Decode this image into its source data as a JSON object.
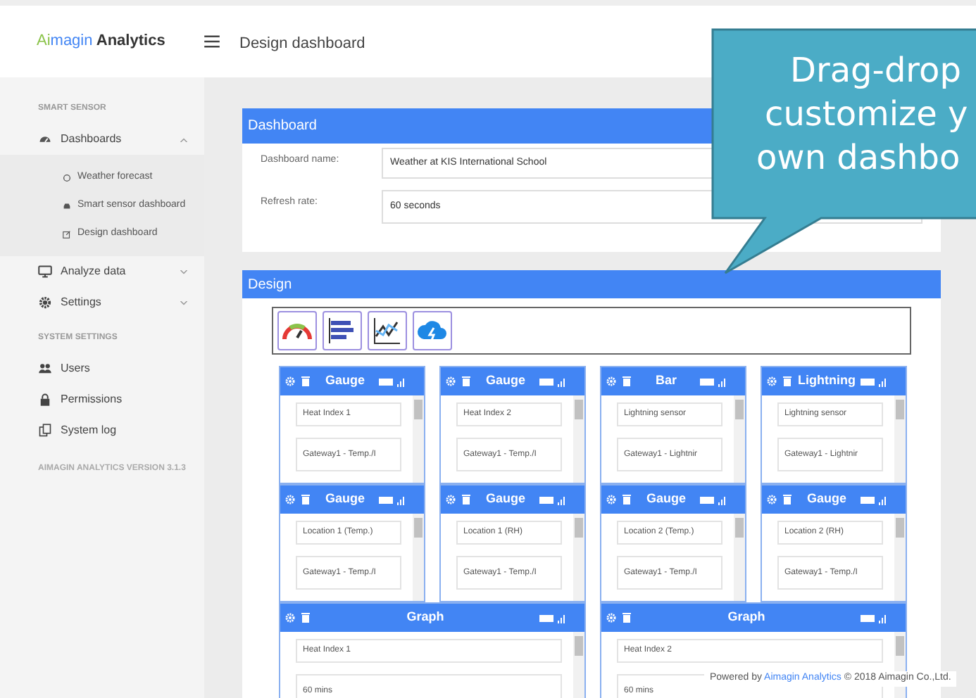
{
  "brand": {
    "first": "Ai",
    "second": "magin",
    "third": " Analytics"
  },
  "page_title": "Design dashboard",
  "sidebar": {
    "sections": [
      {
        "label": "SMART SENSOR",
        "items": [
          {
            "label": "Dashboards",
            "expanded": true,
            "children": [
              {
                "label": "Weather forecast"
              },
              {
                "label": "Smart sensor dashboard"
              },
              {
                "label": "Design dashboard"
              }
            ]
          },
          {
            "label": "Analyze data",
            "expanded": false
          },
          {
            "label": "Settings",
            "expanded": false
          }
        ]
      },
      {
        "label": "SYSTEM SETTINGS",
        "items": [
          {
            "label": "Users"
          },
          {
            "label": "Permissions"
          },
          {
            "label": "System log"
          }
        ]
      }
    ],
    "version": "AIMAGIN ANALYTICS VERSION 3.1.3"
  },
  "dashboard_panel": {
    "title": "Dashboard",
    "fields": [
      {
        "label": "Dashboard name:",
        "value": "Weather at KIS International School"
      },
      {
        "label": "Refresh rate:",
        "value": "60 seconds"
      }
    ]
  },
  "design_panel": {
    "title": "Design",
    "widgets": [
      {
        "title": "Gauge",
        "kind": "small",
        "fields": [
          "Heat Index 1",
          "Gateway1 - Temp./I"
        ]
      },
      {
        "title": "Gauge",
        "kind": "small",
        "fields": [
          "Heat Index 2",
          "Gateway1 - Temp./I"
        ]
      },
      {
        "title": "Bar",
        "kind": "small",
        "fields": [
          "Lightning sensor",
          "Gateway1 - Lightnir"
        ]
      },
      {
        "title": "Lightning",
        "kind": "small",
        "fields": [
          "Lightning sensor",
          "Gateway1 - Lightnir"
        ]
      },
      {
        "title": "Gauge",
        "kind": "small",
        "fields": [
          "Location 1 (Temp.)",
          "Gateway1 - Temp./I"
        ]
      },
      {
        "title": "Gauge",
        "kind": "small",
        "fields": [
          "Location 1 (RH)",
          "Gateway1 - Temp./I"
        ]
      },
      {
        "title": "Gauge",
        "kind": "small",
        "fields": [
          "Location 2 (Temp.)",
          "Gateway1 - Temp./I"
        ]
      },
      {
        "title": "Gauge",
        "kind": "small",
        "fields": [
          "Location 2 (RH)",
          "Gateway1 - Temp./I"
        ]
      },
      {
        "title": "Graph",
        "kind": "wide",
        "fields": [
          "Heat Index 1",
          "60 mins"
        ]
      },
      {
        "title": "Graph",
        "kind": "wide",
        "fields": [
          "Heat Index 2",
          "60 mins"
        ]
      }
    ]
  },
  "callout": {
    "lines": [
      "Drag-drop",
      "customize y",
      "own dashbo"
    ]
  },
  "footer": {
    "before": "Powered by ",
    "link": "Aimagin Analytics",
    "after": " © 2018 Aimagin Co.,Ltd."
  }
}
